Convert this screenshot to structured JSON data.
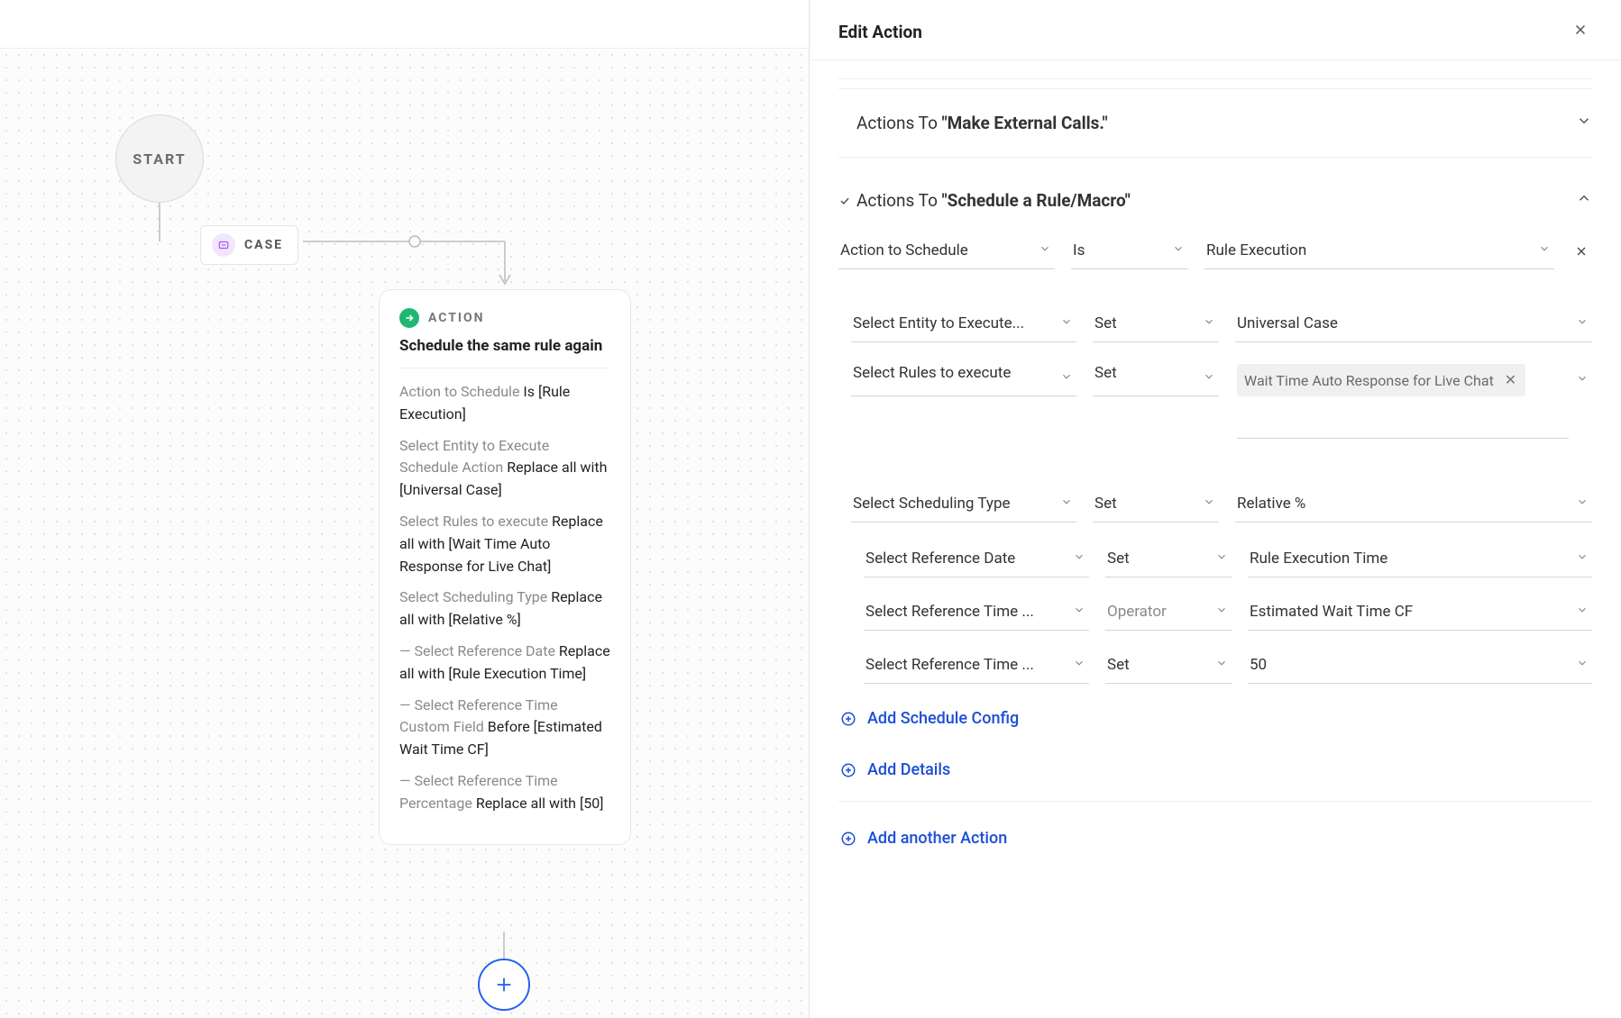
{
  "canvas": {
    "start_label": "START",
    "case_label": "CASE",
    "action_header": "ACTION",
    "action_title": "Schedule the same rule again",
    "lines": [
      {
        "k": "Action to Schedule",
        "v": "Is [Rule Execution]"
      },
      {
        "k": "Select Entity to Execute Schedule Action",
        "v": "Replace all with [Universal Case]"
      },
      {
        "k": "Select Rules to execute",
        "v": "Replace all with [Wait Time Auto Response for Live Chat]"
      },
      {
        "k": "Select Scheduling Type",
        "v": "Replace all with [Relative %]"
      },
      {
        "k": "— Select Reference Date",
        "v": "Replace all with [Rule Execution Time]"
      },
      {
        "k": "— Select Reference Time Custom Field",
        "v": "Before [Estimated Wait Time CF]"
      },
      {
        "k": "— Select Reference Time Percentage",
        "v": "Replace all with [50]"
      }
    ]
  },
  "panel": {
    "title": "Edit Action",
    "sections": [
      {
        "title_prefix": "Actions To ",
        "title_bold": "\"Make External Calls.\"",
        "expanded": false,
        "done": false
      },
      {
        "title_prefix": "Actions To ",
        "title_bold": "\"Schedule a Rule/Macro\"",
        "expanded": true,
        "done": true
      }
    ],
    "top_row": {
      "field": "Action to Schedule",
      "op": "Is",
      "value": "Rule Execution"
    },
    "rows": [
      {
        "field": "Select Entity to Execute...",
        "op": "Set",
        "value": "Universal Case",
        "indent": 1,
        "value_type": "text"
      },
      {
        "field": "Select Rules to execute",
        "op": "Set",
        "value_tag": "Wait Time Auto Response for Live Chat",
        "indent": 1,
        "value_type": "tag"
      },
      {
        "field": "Select Scheduling Type",
        "op": "Set",
        "value": "Relative %",
        "indent": 1,
        "value_type": "text"
      },
      {
        "field": "Select Reference Date",
        "op": "Set",
        "value": "Rule Execution Time",
        "indent": 2,
        "value_type": "text"
      },
      {
        "field": "Select Reference Time ...",
        "op_placeholder": "Operator",
        "value": "Estimated Wait Time CF",
        "indent": 2,
        "value_type": "text"
      },
      {
        "field": "Select Reference Time ...",
        "op": "Set",
        "value": "50",
        "indent": 2,
        "value_type": "text"
      }
    ],
    "links": {
      "add_schedule_config": "Add Schedule Config",
      "add_details": "Add Details",
      "add_another_action": "Add another Action"
    }
  }
}
